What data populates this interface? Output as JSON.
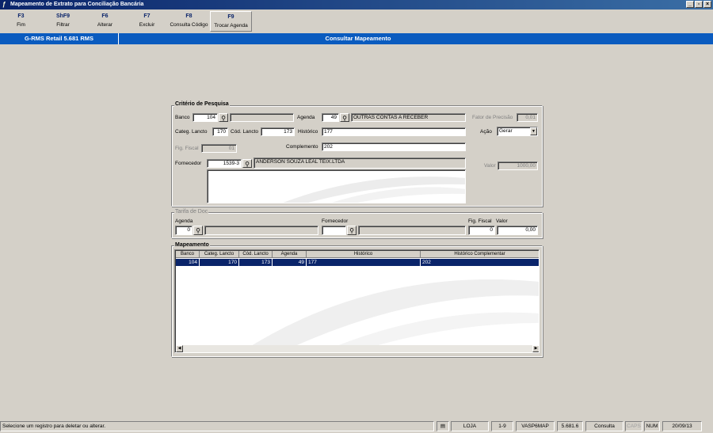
{
  "window": {
    "title": "Mapeamento de Extrato para Conciliação Bancária",
    "controls": [
      "_",
      "▫",
      "×"
    ]
  },
  "toolbar": [
    {
      "key": "F3",
      "label": "Fim"
    },
    {
      "key": "ShF9",
      "label": "Filtrar"
    },
    {
      "key": "F6",
      "label": "Alterar"
    },
    {
      "key": "F7",
      "label": "Excluir"
    },
    {
      "key": "F8",
      "label": "Consulta Código"
    },
    {
      "key": "F9",
      "label": "Trocar Agenda"
    }
  ],
  "header": {
    "app": "G-RMS Retail 5.681 RMS",
    "screen": "Consultar Mapeamento"
  },
  "criterio": {
    "title": "Critério de Pesquisa",
    "banco_label": "Banco",
    "banco": "104",
    "banco_nome": "",
    "agenda_label": "Agenda",
    "agenda": "49",
    "agenda_nome": "OUTRAS CONTAS A RECEBER",
    "fator_label": "Fator de Precisão",
    "fator": "0,01",
    "categ_label": "Categ. Lancto",
    "categ": "170",
    "cod_label": "Cód. Lancto",
    "cod": "173",
    "historico_label": "Histórico",
    "historico": "177",
    "acao_label": "Ação",
    "acao": "Gerar",
    "fig_label": "Fig. Fiscal",
    "fig": "01",
    "complemento_label": "Complemento",
    "complemento": "202",
    "fornecedor_label": "Fornecedor",
    "fornecedor": "1539-3",
    "fornecedor_nome": "ANDERSON SOUZA LEAL TEIX.LTDA",
    "valor_label": "Valor",
    "valor": "1000,00"
  },
  "tarifa": {
    "title": "Tarifa de Doc",
    "agenda_label": "Agenda",
    "agenda": "0",
    "agenda_nome": "",
    "fornecedor_label": "Fornecedor",
    "fornecedor": "",
    "fornecedor_nome": "",
    "fig_label": "Fig. Fiscal",
    "fig": "0",
    "valor_label": "Valor",
    "valor": "0,00"
  },
  "mapeamento": {
    "title": "Mapeamento",
    "columns": [
      "Banco",
      "Categ. Lancto",
      "Cód. Lancto",
      "Agenda",
      "Histórico",
      "Histórico Complementar"
    ],
    "rows": [
      [
        "104",
        "170",
        "173",
        "49",
        "177",
        "202"
      ]
    ]
  },
  "status": {
    "message": "Selecione um registro para deletar ou alterar.",
    "loja": "LOJA",
    "pages": "1-9",
    "program": "VASP6MAP",
    "version": "5.681.6",
    "mode": "Consulta",
    "caps": "CAPS",
    "num": "NUM",
    "date": "20/09/13"
  },
  "icons": {
    "binoculars": "binoculars-icon",
    "notepad": "notepad-icon",
    "app": "app-icon"
  },
  "colors": {
    "title_bar": "#0a246a",
    "header_bar": "#0a5bbf",
    "selection": "#0a246a"
  }
}
